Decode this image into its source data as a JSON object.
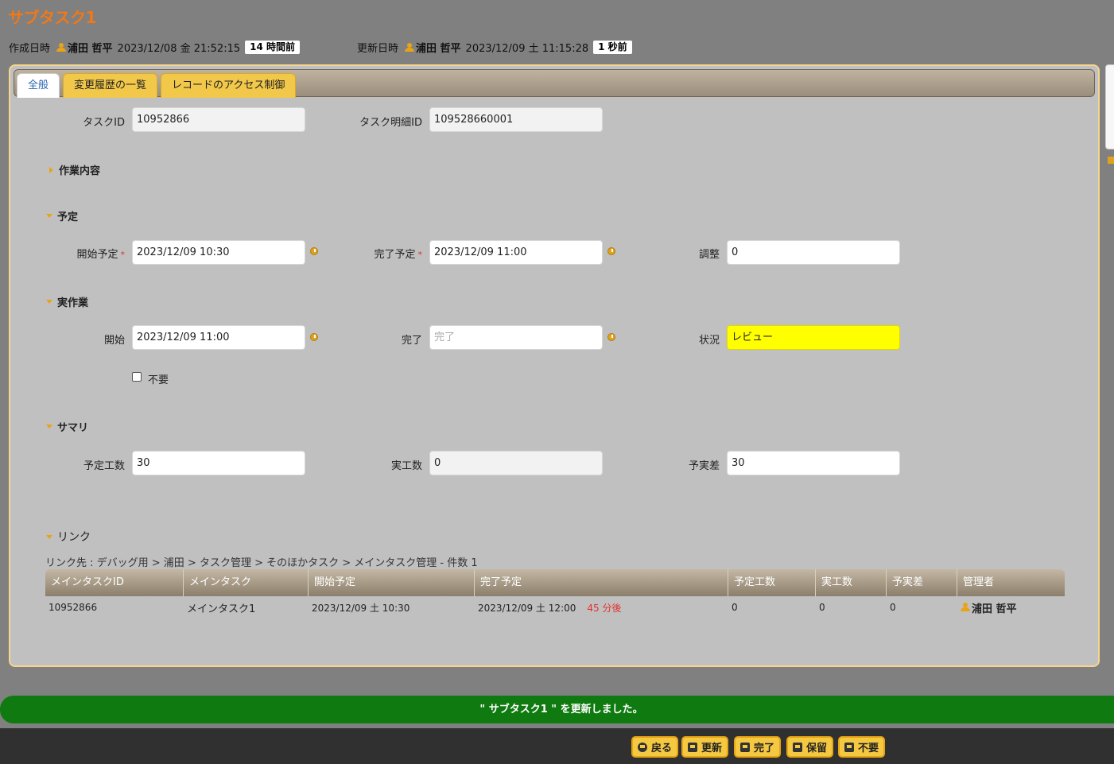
{
  "page": {
    "title": "サブタスク1"
  },
  "meta": {
    "created_label": "作成日時",
    "created_user": "浦田 哲平",
    "created_date": "2023/12/08 金 21:52:15",
    "created_ago": "14 時間前",
    "updated_label": "更新日時",
    "updated_user": "浦田 哲平",
    "updated_date": "2023/12/09 土 11:15:28",
    "updated_ago": "1 秒前"
  },
  "tabs": [
    {
      "label": "全般",
      "active": true
    },
    {
      "label": "変更履歴の一覧",
      "active": false
    },
    {
      "label": "レコードのアクセス制御",
      "active": false
    }
  ],
  "fields": {
    "task_id_label": "タスクID",
    "task_id": "10952866",
    "task_detail_id_label": "タスク明細ID",
    "task_detail_id": "109528660001"
  },
  "sections": {
    "work": "作業内容",
    "plan": "予定",
    "actual": "実作業",
    "summary": "サマリ",
    "link": "リンク"
  },
  "plan": {
    "start_label": "開始予定",
    "start": "2023/12/09 10:30",
    "end_label": "完了予定",
    "end": "2023/12/09 11:00",
    "adjust_label": "調整",
    "adjust": "0",
    "required_mark": "*"
  },
  "actual": {
    "start_label": "開始",
    "start": "2023/12/09 11:00",
    "end_label": "完了",
    "end_placeholder": "完了",
    "status_label": "状況",
    "status": "レビュー",
    "status_color": "#ffff00",
    "unneeded_label": "不要",
    "unneeded_checked": false
  },
  "summary": {
    "planned_hours_label": "予定工数",
    "planned_hours": "30",
    "actual_hours_label": "実工数",
    "actual_hours": "0",
    "diff_label": "予実差",
    "diff": "30"
  },
  "link": {
    "breadcrumb": "リンク先 : デバッグ用 > 浦田 > タスク管理 > そのほかタスク > メインタスク管理 - 件数 1",
    "columns": [
      "メインタスクID",
      "メインタスク",
      "開始予定",
      "完了予定",
      "予定工数",
      "実工数",
      "予実差",
      "管理者"
    ],
    "rows": [
      {
        "id": "10952866",
        "name": "メインタスク1",
        "start": "2023/12/09 土 10:30",
        "end": "2023/12/09 土 12:00",
        "end_relative": "45 分後",
        "planned": "0",
        "actual": "0",
        "diff": "0",
        "manager": "浦田 哲平"
      }
    ]
  },
  "toast": {
    "message": "\" サブタスク1 \" を更新しました。",
    "color": "#0f7a0f"
  },
  "buttons": {
    "back": "戻る",
    "update": "更新",
    "complete": "完了",
    "hold": "保留",
    "unneeded": "不要"
  },
  "colors": {
    "accent": "#f07818",
    "tab": "#f2c84a"
  }
}
